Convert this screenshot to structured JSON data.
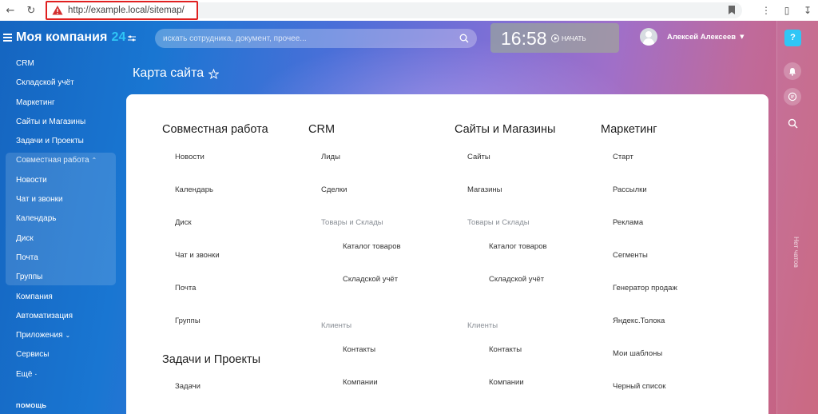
{
  "browser": {
    "url": "http://example.local/sitemap/"
  },
  "header": {
    "brand_name": "Моя компания",
    "brand_num": "24",
    "search_placeholder": "искать сотрудника, документ, прочее...",
    "clock_time": "16:58",
    "clock_start": "НАЧАТЬ",
    "user_name": "Алексей Алексеев"
  },
  "menu": {
    "items": [
      "CRM",
      "Складской учёт",
      "Маркетинг",
      "Сайты и Магазины",
      "Задачи и Проекты"
    ],
    "group_title": "Совместная работа",
    "group_items": [
      "Новости",
      "Чат и звонки",
      "Календарь",
      "Диск",
      "Почта",
      "Группы"
    ],
    "bottom_items": [
      "Компания",
      "Автоматизация",
      "Приложения",
      "Сервисы",
      "Ещё ·"
    ],
    "help": "ПОМОЩЬ"
  },
  "rail": {
    "help_label": "?",
    "no_chats": "Нет чатов"
  },
  "page": {
    "title": "Карта сайта"
  },
  "sitemap": {
    "col1": {
      "title": "Совместная работа",
      "links": [
        "Новости",
        "Календарь",
        "Диск",
        "Чат и звонки",
        "Почта",
        "Группы"
      ],
      "title2": "Задачи и Проекты",
      "links2": [
        "Задачи"
      ]
    },
    "col2": {
      "title": "CRM",
      "links": [
        "Лиды",
        "Сделки"
      ],
      "sub1": "Товары и Склады",
      "sub1_links": [
        "Каталог товаров",
        "Складской учёт"
      ],
      "sub2": "Клиенты",
      "sub2_links": [
        "Контакты",
        "Компании"
      ]
    },
    "col3": {
      "title": "Сайты и Магазины",
      "links": [
        "Сайты",
        "Магазины"
      ],
      "sub1": "Товары и Склады",
      "sub1_links": [
        "Каталог товаров",
        "Складской учёт"
      ],
      "sub2": "Клиенты",
      "sub2_links": [
        "Контакты",
        "Компании"
      ]
    },
    "col4": {
      "title": "Маркетинг",
      "links": [
        "Старт",
        "Рассылки",
        "Реклама",
        "Сегменты",
        "Генератор продаж",
        "Яндекс.Толока",
        "Мои шаблоны",
        "Черный список"
      ]
    }
  }
}
